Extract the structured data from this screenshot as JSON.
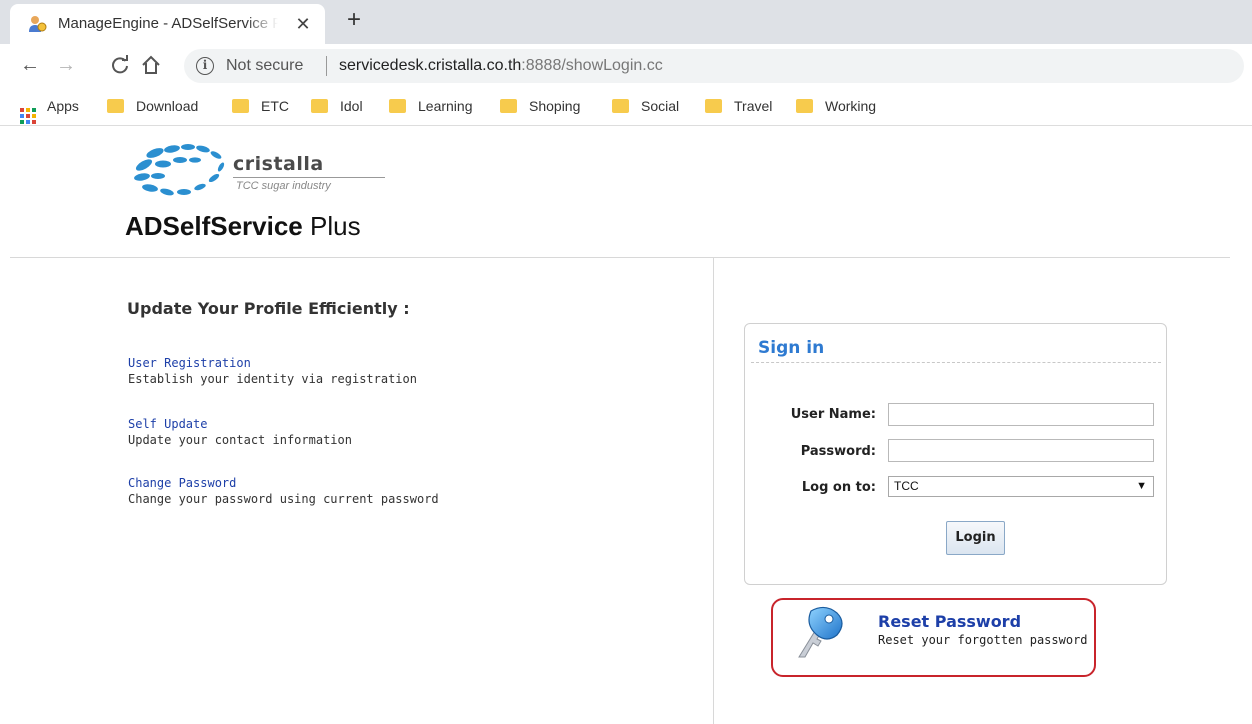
{
  "browser": {
    "tab_title": "ManageEngine - ADSelfService Plus",
    "tab_close": "✕",
    "new_tab": "+",
    "not_secure": "Not secure",
    "url_host": "servicedesk.cristalla.co.th",
    "url_rest": ":8888/showLogin.cc",
    "bookmarks": [
      "Apps",
      "Download",
      "ETC",
      "Idol",
      "Learning",
      "Shoping",
      "Social",
      "Travel",
      "Working"
    ]
  },
  "header": {
    "brand_name": "cristalla",
    "brand_sub": "TCC sugar industry",
    "product_bold": "ADSelfService",
    "product_light": " Plus"
  },
  "features": {
    "title": "Update Your Profile Efficiently :",
    "items": [
      {
        "link": "User Registration",
        "desc": "Establish your identity via registration"
      },
      {
        "link": "Self Update",
        "desc": "Update your contact information"
      },
      {
        "link": "Change Password",
        "desc": "Change your password using current password"
      }
    ]
  },
  "signin": {
    "title": "Sign in",
    "username_label": "User Name:",
    "username_value": "",
    "password_label": "Password:",
    "password_value": "",
    "logon_label": "Log on to:",
    "logon_value": "TCC",
    "login_button": "Login"
  },
  "reset": {
    "title": "Reset Password",
    "subtitle": "Reset your forgotten password"
  },
  "colors": {
    "link": "#1d3fa8",
    "signin_title": "#2e7ad1",
    "highlight_border": "#c8242b",
    "folder": "#f7cb4d"
  }
}
